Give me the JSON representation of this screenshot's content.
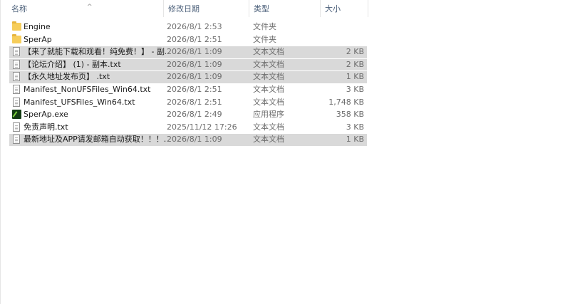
{
  "columns": {
    "name": "名称",
    "date": "修改日期",
    "type": "类型",
    "size": "大小",
    "sort_indicator": "^"
  },
  "files": [
    {
      "name": "Engine",
      "date": "2026/8/1 2:53",
      "type": "文件夹",
      "size": "",
      "icon": "folder-icon",
      "selected": false
    },
    {
      "name": "SperAp",
      "date": "2026/8/1 2:51",
      "type": "文件夹",
      "size": "",
      "icon": "folder-icon",
      "selected": false
    },
    {
      "name": "【来了就能下载和观看！纯免费！】 - 副...",
      "date": "2026/8/1 1:09",
      "type": "文本文档",
      "size": "2 KB",
      "icon": "text-file-icon",
      "selected": true
    },
    {
      "name": "【论坛介绍】 (1) - 副本.txt",
      "date": "2026/8/1 1:09",
      "type": "文本文档",
      "size": "2 KB",
      "icon": "text-file-icon",
      "selected": true
    },
    {
      "name": "【永久地址发布页】 .txt",
      "date": "2026/8/1 1:09",
      "type": "文本文档",
      "size": "1 KB",
      "icon": "text-file-icon",
      "selected": true
    },
    {
      "name": "Manifest_NonUFSFiles_Win64.txt",
      "date": "2026/8/1 2:51",
      "type": "文本文档",
      "size": "3 KB",
      "icon": "text-file-icon",
      "selected": false
    },
    {
      "name": "Manifest_UFSFiles_Win64.txt",
      "date": "2026/8/1 2:51",
      "type": "文本文档",
      "size": "1,748 KB",
      "icon": "text-file-icon",
      "selected": false
    },
    {
      "name": "SperAp.exe",
      "date": "2026/8/1 2:49",
      "type": "应用程序",
      "size": "358 KB",
      "icon": "application-icon",
      "selected": false
    },
    {
      "name": "免责声明.txt",
      "date": "2025/11/12 17:26",
      "type": "文本文档",
      "size": "3 KB",
      "icon": "text-file-icon",
      "selected": false
    },
    {
      "name": "最新地址及APP请发邮箱自动获取！！！...",
      "date": "2026/8/1 1:09",
      "type": "文本文档",
      "size": "1 KB",
      "icon": "text-file-icon",
      "selected": true
    }
  ]
}
